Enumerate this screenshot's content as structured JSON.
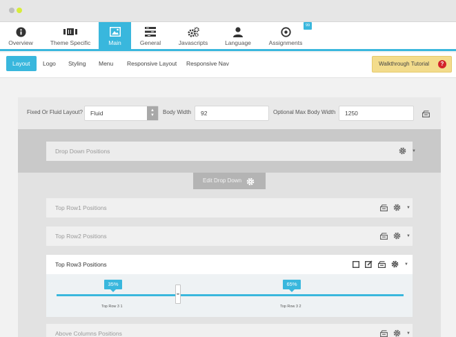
{
  "main_nav": {
    "items": [
      {
        "label": "Overview",
        "icon": "info-icon"
      },
      {
        "label": "Theme Specific",
        "icon": "film-icon"
      },
      {
        "label": "Main",
        "icon": "image-icon"
      },
      {
        "label": "General",
        "icon": "list-icon"
      },
      {
        "label": "Javascripts",
        "icon": "gears-icon"
      },
      {
        "label": "Language",
        "icon": "user-icon"
      },
      {
        "label": "Assignments",
        "icon": "target-icon"
      }
    ],
    "active": "Main",
    "assignments_badge": "99"
  },
  "sub_nav": {
    "items": [
      "Layout",
      "Logo",
      "Styling",
      "Menu",
      "Responsive Layout",
      "Responsive Nav"
    ],
    "active": "Layout",
    "walkthrough_label": "Walkthrough Tutorial",
    "help_symbol": "?"
  },
  "layout_settings": {
    "layout_label": "Fixed Or Fluid Layout?",
    "layout_value": "Fluid",
    "body_width_label": "Body Width",
    "body_width_value": "92",
    "max_width_label": "Optional Max Body Width",
    "max_width_value": "1250"
  },
  "rows": {
    "drop_down": "Drop Down Positions",
    "edit_drop_down": "Edit Drop Down",
    "top_row1": "Top Row1 Positions",
    "top_row2": "Top Row2 Positions",
    "top_row3": "Top Row3 Positions",
    "above_columns": "Above Columns Positions"
  },
  "slider": {
    "left_percent": "35%",
    "right_percent": "65%",
    "left_label": "Top Row 3 1",
    "right_label": "Top Row 3 2",
    "split_fraction": 0.35
  },
  "colors": {
    "accent": "#39b7dd",
    "walkthrough_bg": "#f3dc8c",
    "help_red": "#d2232a"
  }
}
